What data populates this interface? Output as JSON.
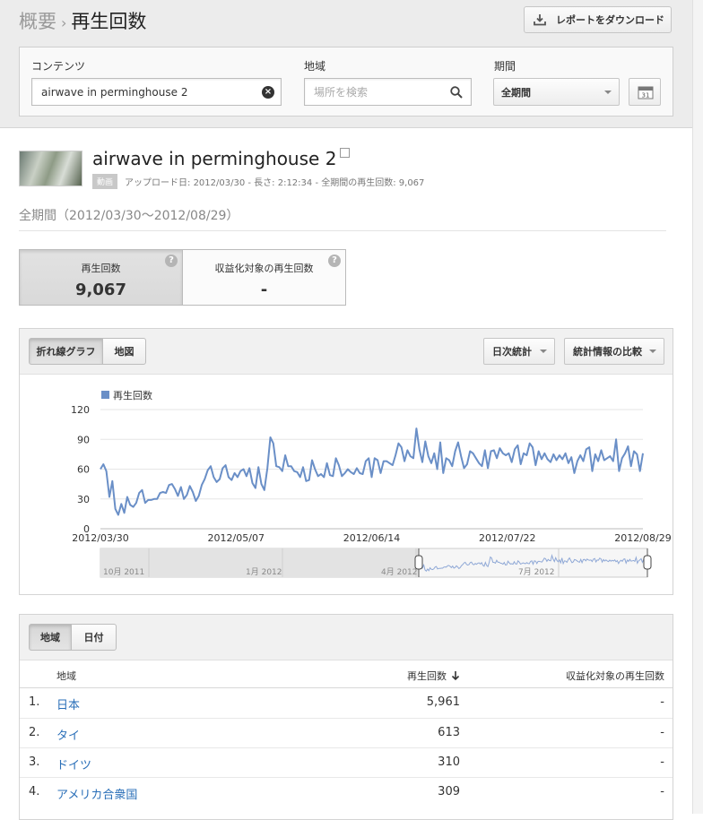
{
  "breadcrumb": {
    "parent": "概要",
    "current": "再生回数"
  },
  "download_button": "レポートをダウンロード",
  "filters": {
    "content_label": "コンテンツ",
    "content_value": "airwave in perminghouse 2",
    "region_label": "地域",
    "region_placeholder": "場所を検索",
    "period_label": "期間",
    "period_value": "全期間",
    "calendar_day": "31"
  },
  "video": {
    "title": "airwave in perminghouse 2",
    "badge": "動画",
    "meta": "アップロード日: 2012/03/30 - 長さ: 2:12:34 - 全期間の再生回数: 9,067"
  },
  "period_text": "全期間（2012/03/30〜2012/08/29）",
  "metrics": [
    {
      "label": "再生回数",
      "value": "9,067"
    },
    {
      "label": "収益化対象の再生回数",
      "value": "-"
    }
  ],
  "chart_controls": {
    "tab_line": "折れ線グラフ",
    "tab_map": "地図",
    "daily": "日次統計",
    "compare": "統計情報の比較"
  },
  "chart_data": {
    "type": "line",
    "legend": "再生回数",
    "series": [
      {
        "name": "再生回数",
        "color": "#6a8fc7",
        "values": [
          60,
          65,
          58,
          32,
          48,
          20,
          14,
          25,
          16,
          32,
          24,
          22,
          26,
          36,
          39,
          26,
          29,
          29,
          30,
          30,
          36,
          37,
          36,
          44,
          45,
          40,
          33,
          42,
          30,
          34,
          43,
          37,
          28,
          33,
          44,
          50,
          59,
          63,
          52,
          47,
          50,
          61,
          64,
          52,
          49,
          56,
          52,
          58,
          60,
          53,
          61,
          46,
          41,
          62,
          45,
          39,
          61,
          92,
          86,
          63,
          62,
          58,
          74,
          63,
          63,
          58,
          57,
          52,
          62,
          48,
          49,
          69,
          60,
          53,
          55,
          52,
          66,
          54,
          53,
          71,
          64,
          53,
          56,
          60,
          57,
          55,
          61,
          56,
          55,
          68,
          71,
          52,
          71,
          69,
          56,
          68,
          68,
          66,
          64,
          74,
          86,
          82,
          68,
          79,
          73,
          71,
          101,
          80,
          67,
          88,
          73,
          66,
          76,
          60,
          87,
          56,
          71,
          69,
          63,
          78,
          87,
          73,
          61,
          65,
          78,
          76,
          71,
          66,
          63,
          79,
          61,
          78,
          79,
          71,
          81,
          76,
          74,
          76,
          67,
          80,
          84,
          65,
          76,
          74,
          86,
          82,
          64,
          78,
          70,
          76,
          70,
          67,
          75,
          69,
          74,
          70,
          76,
          66,
          72,
          56,
          68,
          74,
          68,
          80,
          82,
          58,
          75,
          68,
          79,
          69,
          71,
          73,
          68,
          90,
          58,
          71,
          76,
          83,
          63,
          78,
          75,
          58,
          76
        ]
      }
    ],
    "x_ticks": [
      "2012/03/30",
      "2012/05/07",
      "2012/06/14",
      "2012/07/22",
      "2012/08/29"
    ],
    "y_ticks": [
      0,
      30,
      60,
      90,
      120
    ],
    "ylim": [
      0,
      120
    ],
    "grid": true,
    "legend_position": "top-left",
    "navigator_labels": [
      "10月 2011",
      "1月 2012",
      "4月 2012",
      "7月 2012"
    ]
  },
  "table_tabs": {
    "region": "地域",
    "date": "日付"
  },
  "table": {
    "headers": {
      "region": "地域",
      "views": "再生回数",
      "monetized": "収益化対象の再生回数"
    },
    "rows": [
      {
        "rank": "1.",
        "name": "日本",
        "views": "5,961",
        "monetized": "-"
      },
      {
        "rank": "2.",
        "name": "タイ",
        "views": "613",
        "monetized": "-"
      },
      {
        "rank": "3.",
        "name": "ドイツ",
        "views": "310",
        "monetized": "-"
      },
      {
        "rank": "4.",
        "name": "アメリカ合衆国",
        "views": "309",
        "monetized": "-"
      }
    ]
  }
}
